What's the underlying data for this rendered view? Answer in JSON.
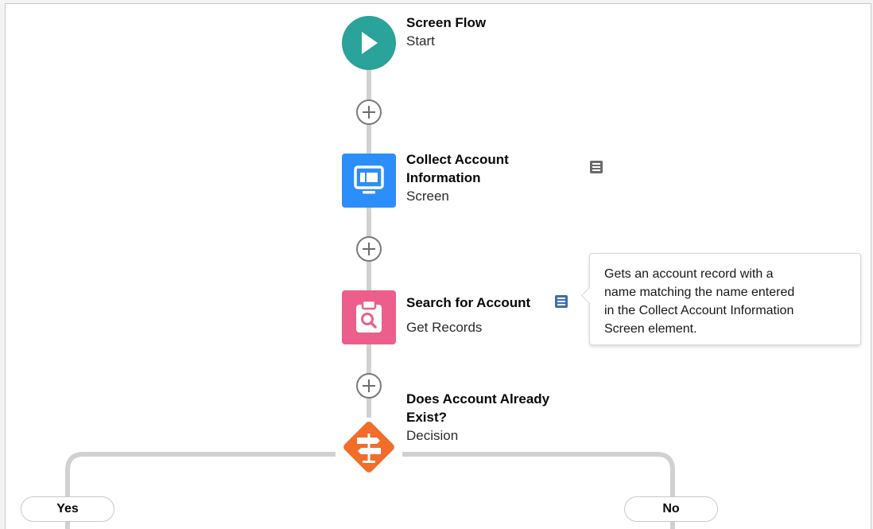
{
  "colors": {
    "start": "#2aa39a",
    "screen": "#2c8ef8",
    "get_records": "#ec5f8c",
    "decision": "#f26c2a",
    "connector": "#d1d1d1",
    "description_icon": "#3c6fb4"
  },
  "nodes": {
    "start": {
      "title": "Screen Flow",
      "subtitle": "Start",
      "icon": "play-icon"
    },
    "screen": {
      "title_line1": "Collect Account",
      "title_line2": "Information",
      "subtitle": "Screen",
      "icon": "screen-monitor-icon"
    },
    "get_records": {
      "title": "Search for Account",
      "subtitle": "Get Records",
      "icon": "clipboard-search-icon"
    },
    "decision": {
      "title_line1": "Does Account Already",
      "title_line2": "Exist?",
      "subtitle": "Decision",
      "icon": "signpost-icon"
    }
  },
  "tooltip": {
    "line1": "Gets an account record with a",
    "line2": "name matching the name entered",
    "line3": "in the Collect Account Information",
    "line4": "Screen element."
  },
  "outcomes": {
    "yes": "Yes",
    "no": "No"
  }
}
